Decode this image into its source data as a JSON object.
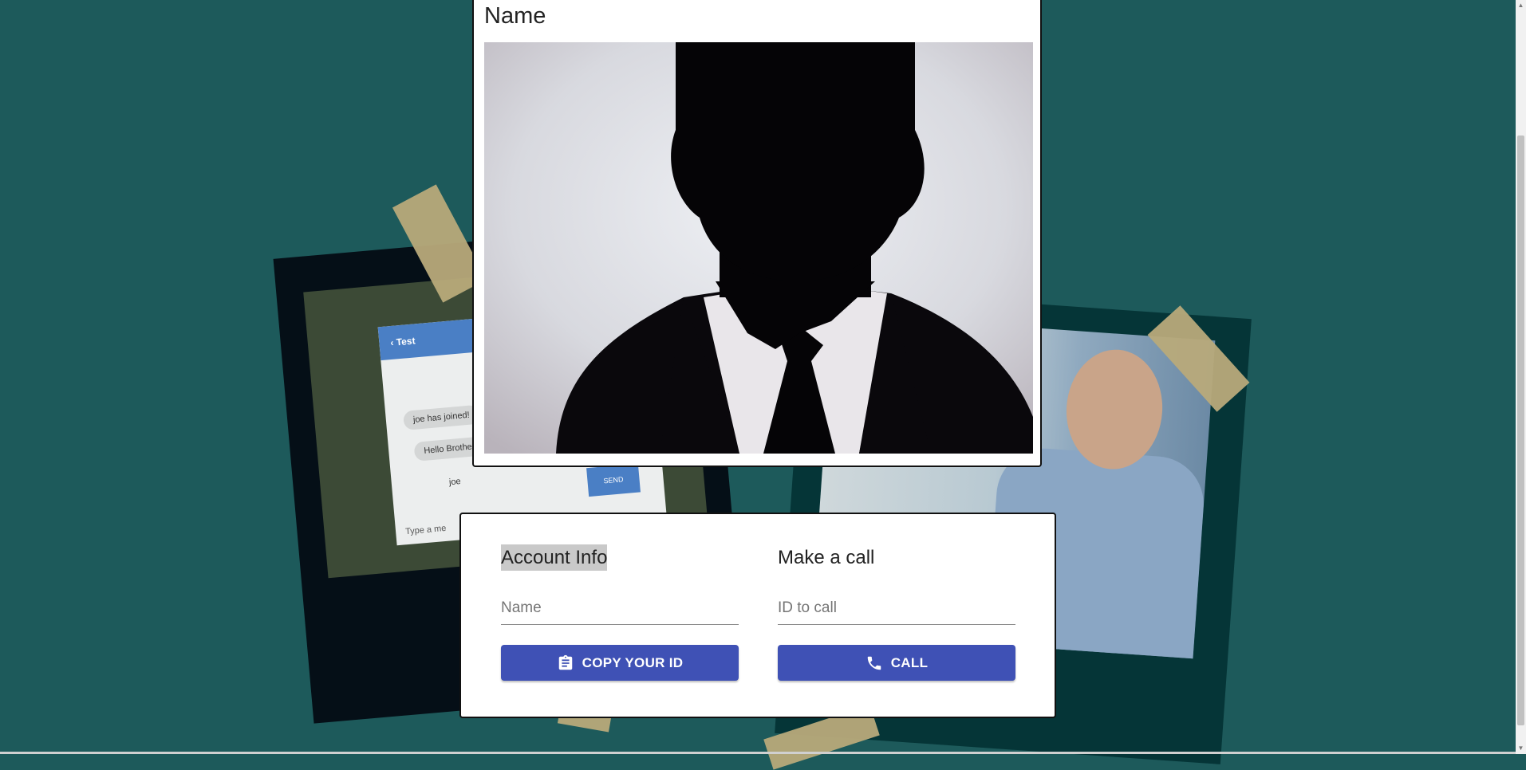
{
  "video": {
    "title": "Name"
  },
  "background_chat": {
    "header": "Test",
    "messages": [
      "joe has joined!",
      "Hello Brother",
      "joe"
    ],
    "send_label": "SEND",
    "input_placeholder": "Type a me"
  },
  "account": {
    "title": "Account Info",
    "name_placeholder": "Name",
    "copy_button_label": "COPY YOUR ID",
    "copy_icon": "clipboard-icon"
  },
  "call": {
    "title": "Make a call",
    "id_placeholder": "ID to call",
    "call_button_label": "CALL",
    "call_icon": "phone-icon"
  },
  "colors": {
    "background": "#1d5a5b",
    "button": "#3f51b5"
  }
}
